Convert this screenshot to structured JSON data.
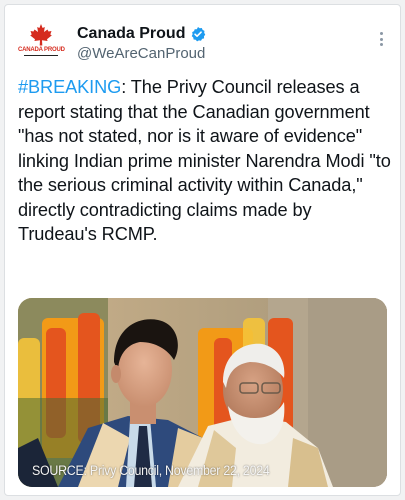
{
  "account": {
    "avatar_text": "CANADA PROUD",
    "display_name": "Canada Proud",
    "handle": "@WeAreCanProud",
    "verified": true
  },
  "tweet": {
    "hashtag": "#BREAKING",
    "body": ": The Privy Council releases a report stating that the Canadian government \"has not stated, nor is it aware of evidence\" linking Indian prime minister Narendra Modi \"to the serious criminal activity within Canada,\" directly contradicting claims made by Trudeau's RCMP."
  },
  "media": {
    "caption": "SOURCE: Privy Council, November 22, 2024"
  },
  "colors": {
    "hashtag": "#1d9bf0",
    "verified_badge": "#1d9bf0",
    "brand_red": "#d52b1e"
  },
  "icons": [
    "maple-leaf-icon",
    "verified-badge-icon",
    "more-options-icon"
  ]
}
